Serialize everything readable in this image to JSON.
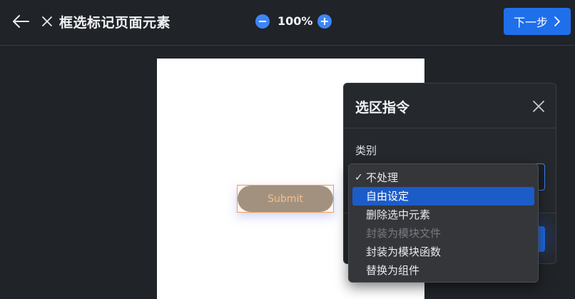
{
  "header": {
    "title": "框选标记页面元素",
    "zoom": "100%",
    "next_label": "下一步"
  },
  "canvas": {
    "submit_label": "Submit"
  },
  "panel": {
    "title": "选区指令",
    "category_label": "类别"
  },
  "dropdown": {
    "items": [
      {
        "label": "不处理",
        "checked": true
      },
      {
        "label": "自由设定",
        "highlighted": true
      },
      {
        "label": "删除选中元素"
      },
      {
        "label": "封装为模块文件",
        "disabled": true
      },
      {
        "label": "封装为模块函数"
      },
      {
        "label": "替换为组件"
      }
    ],
    "check_mark": "✓"
  },
  "colors": {
    "accent": "#1f6feb",
    "background": "#202328",
    "selection_border": "#f0a24a"
  }
}
